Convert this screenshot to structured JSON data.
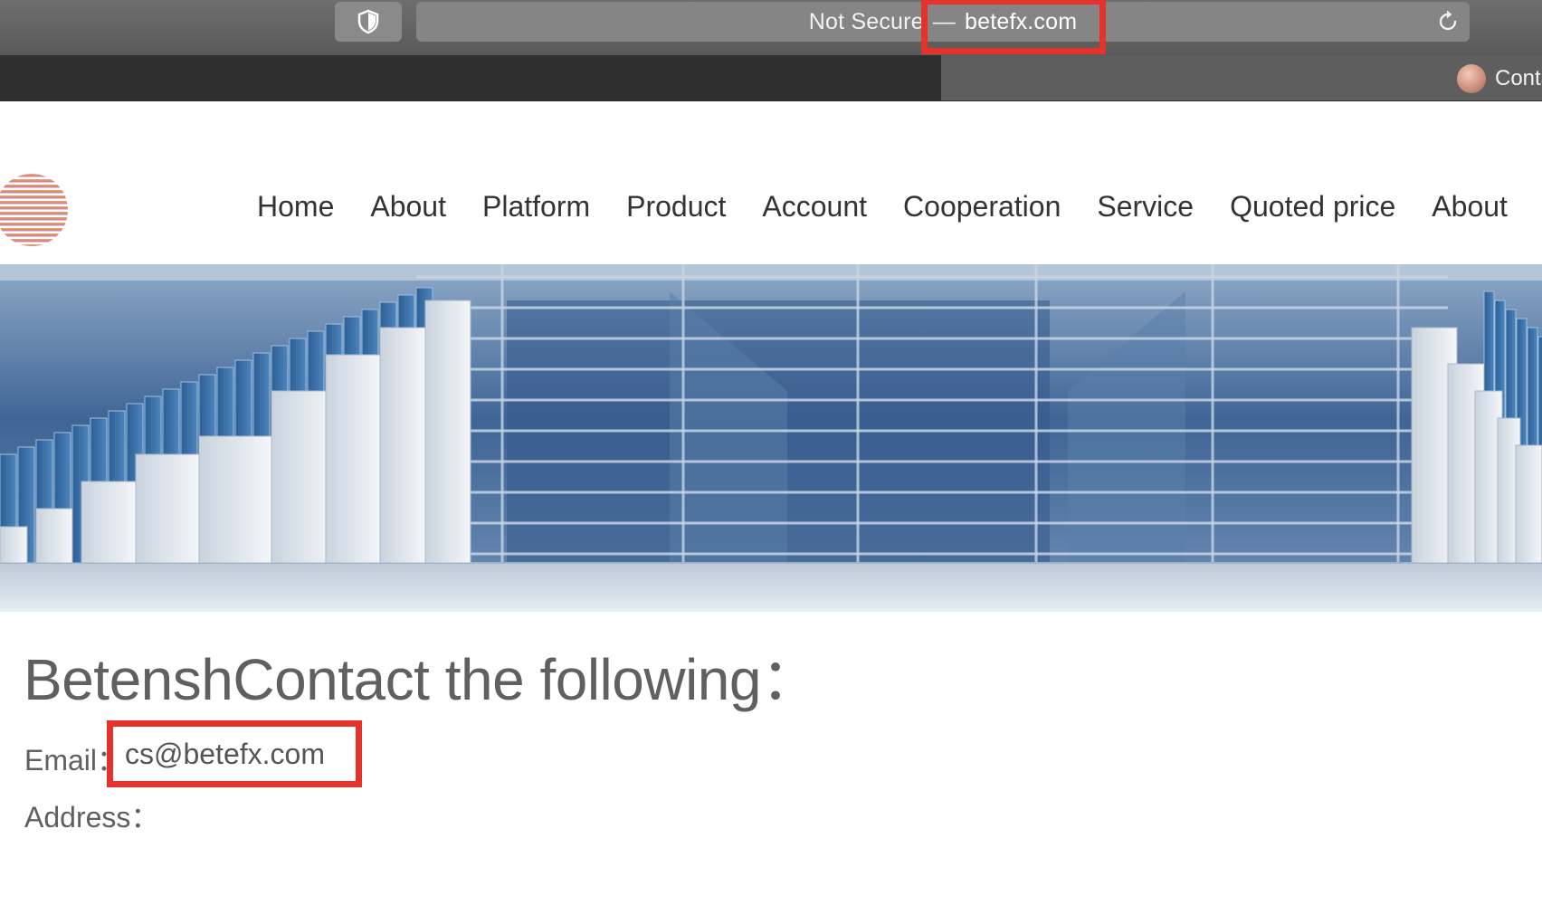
{
  "browser": {
    "url_prefix": "Not Secure",
    "url_separator": "—",
    "url_domain": "betefx.com",
    "active_tab_title": "Contact",
    "icons": [
      "shield-icon",
      "reload-icon",
      "favicon"
    ]
  },
  "nav": {
    "items": [
      "Home",
      "About",
      "Platform",
      "Product",
      "Account",
      "Cooperation",
      "Service",
      "Quoted price",
      "About"
    ]
  },
  "content": {
    "title": "BetenshContact the following：",
    "email_label": "Email：",
    "email_value": "cs@betefx.com",
    "address_label": "Address："
  },
  "colors": {
    "highlight": "#e5322a",
    "text": "#606060",
    "nav_text": "#333333"
  }
}
